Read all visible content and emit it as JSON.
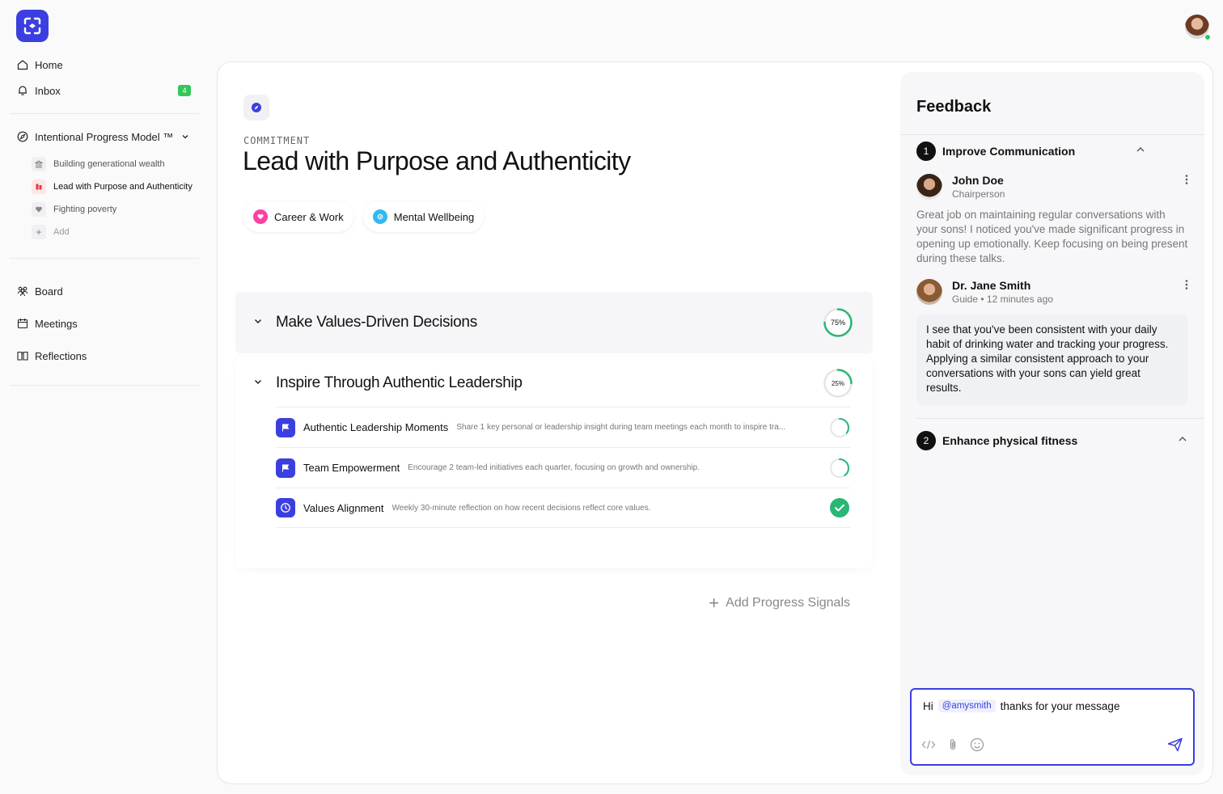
{
  "sidebar": {
    "home": "Home",
    "inbox": "Inbox",
    "inbox_count": "4",
    "model": "Intentional Progress Model ™",
    "commitments": [
      "Building generational wealth",
      "Lead with Purpose and Authenticity",
      "Fighting poverty"
    ],
    "add": "Add",
    "board": "Board",
    "meetings": "Meetings",
    "reflections": "Reflections"
  },
  "main": {
    "kicker": "COMMITMENT",
    "title": "Lead with Purpose and Authenticity",
    "tags": [
      "Career & Work",
      "Mental Wellbeing"
    ],
    "sections": [
      {
        "title": "Make Values-Driven Decisions",
        "progress": 75,
        "progress_label": "75%"
      },
      {
        "title": "Inspire Through Authentic Leadership",
        "progress": 25,
        "progress_label": "25%"
      }
    ],
    "signals": [
      {
        "name": "Authentic Leadership Moments",
        "desc": "Share 1 key personal or leadership insight during team meetings each month to inspire tra...",
        "progress": 35
      },
      {
        "name": "Team Empowerment",
        "desc": "Encourage 2 team-led initiatives each quarter, focusing on growth and ownership.",
        "progress": 40
      },
      {
        "name": "Values Alignment",
        "desc": "Weekly 30-minute reflection on how recent decisions reflect core values.",
        "progress": 100
      }
    ],
    "add_signals": "Add Progress Signals"
  },
  "feedback": {
    "title": "Feedback",
    "topics": [
      {
        "num": "1",
        "name": "Improve Communication"
      },
      {
        "num": "2",
        "name": "Enhance physical fitness"
      }
    ],
    "comments": [
      {
        "name": "John Doe",
        "role": "Chairperson",
        "text": "Great job on maintaining regular conversations with your sons! I noticed you've made significant progress in opening up emotionally. Keep focusing on being present during these talks."
      },
      {
        "name": "Dr. Jane Smith",
        "role": "Guide • 12 minutes ago",
        "text": "I see that you've been consistent with your daily habit of drinking water and tracking your progress. Applying a similar consistent approach to your conversations with your sons can yield great results."
      }
    ],
    "composer": {
      "prefix": "Hi",
      "mention": "@amysmith",
      "suffix": "thanks for your message"
    }
  },
  "colors": {
    "brand": "#3b3fe0",
    "success": "#34c759",
    "ring": "#2ab673",
    "career_tag": "#ff3fa4",
    "wellbeing_tag": "#32b9f0"
  }
}
